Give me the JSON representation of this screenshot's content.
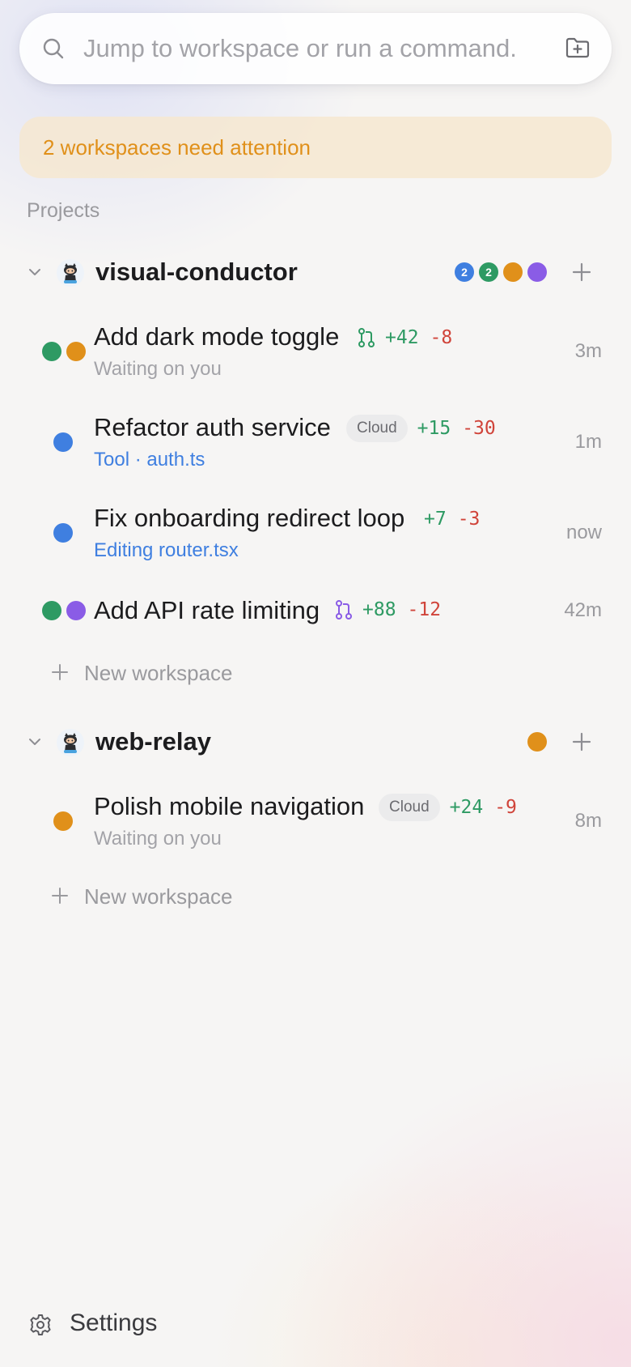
{
  "search": {
    "placeholder": "Jump to workspace or run a command.",
    "search_icon": "search-icon",
    "new_folder_icon": "folder-plus-icon"
  },
  "attention_banner": "2 workspaces need attention",
  "section_label": "Projects",
  "colors": {
    "green": "#2e9a63",
    "orange": "#e0901a",
    "purple": "#8a5ce6",
    "blue": "#3f7fe0",
    "red": "#d0443a"
  },
  "projects": [
    {
      "name": "visual-conductor",
      "avatar_icon": "github-octocat-icon",
      "status_badges": [
        {
          "color": "blue",
          "count": "2"
        },
        {
          "color": "green",
          "count": "2"
        },
        {
          "color": "orange",
          "count": ""
        },
        {
          "color": "purple",
          "count": ""
        }
      ],
      "workspaces": [
        {
          "title": "Add dark mode toggle",
          "status_dots": [
            "green",
            "orange"
          ],
          "pr_icon_color": "green",
          "additions": "+42",
          "deletions": "-8",
          "subtitle": "Waiting on you",
          "time": "3m"
        },
        {
          "title": "Refactor auth service",
          "status_dots": [
            "blue"
          ],
          "tag": "Cloud",
          "additions": "+15",
          "deletions": "-30",
          "subtitle": "Tool · auth.ts",
          "time": "1m"
        },
        {
          "title": "Fix onboarding redirect loop",
          "status_dots": [
            "blue"
          ],
          "additions": "+7",
          "deletions": "-3",
          "subtitle": "Editing router.tsx",
          "time": "now"
        },
        {
          "title": "Add API rate limiting",
          "status_dots": [
            "green",
            "purple"
          ],
          "pr_icon_color": "purple",
          "additions": "+88",
          "deletions": "-12",
          "subtitle": "",
          "time": "42m"
        }
      ],
      "new_workspace_label": "New workspace"
    },
    {
      "name": "web-relay",
      "avatar_icon": "github-octocat-icon",
      "status_badges": [
        {
          "color": "orange",
          "count": ""
        }
      ],
      "workspaces": [
        {
          "title": "Polish mobile navigation",
          "status_dots": [
            "orange"
          ],
          "tag": "Cloud",
          "additions": "+24",
          "deletions": "-9",
          "subtitle": "Waiting on you",
          "time": "8m"
        }
      ],
      "new_workspace_label": "New workspace"
    }
  ],
  "settings": {
    "label": "Settings",
    "icon": "gear-icon"
  }
}
